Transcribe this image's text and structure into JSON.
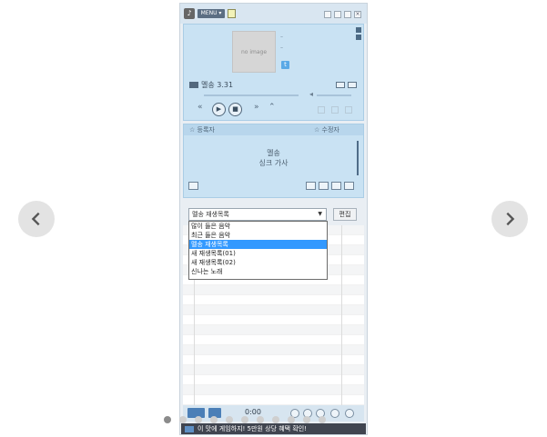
{
  "navigation": {
    "prev_icon": "chevron-left-icon",
    "next_icon": "chevron-right-icon"
  },
  "player": {
    "topbar": {
      "menu_label": "MENU ▾"
    },
    "cover": {
      "placeholder": "no image"
    },
    "track": {
      "title_line": "–",
      "artist_line": "–"
    },
    "playback": {
      "time_text": "멜송 3.31",
      "current_time": "0:00"
    },
    "lyrics": {
      "left_label": "☆ 등록자",
      "right_label": "☆ 수정자",
      "line1": "멜송",
      "line2": "싱크 가사"
    },
    "playlist": {
      "selected": "멜송 재생목록",
      "edit_label": "편집",
      "options": [
        "많이 들은 음악",
        "최근 들은 음악",
        "멜송 재생목록",
        "새 재생목록(01)",
        "새 재생목록(02)",
        "신나는 노래"
      ],
      "selected_index": 2
    },
    "ad_text": "이 맛에 게임하지! 5만원 상당 혜택 확인!"
  },
  "colors": {
    "panel": "#c9e2f3",
    "accent": "#3399ff",
    "ad_bg": "#404550"
  },
  "carousel": {
    "dot_count": 11,
    "active_index": 0
  }
}
